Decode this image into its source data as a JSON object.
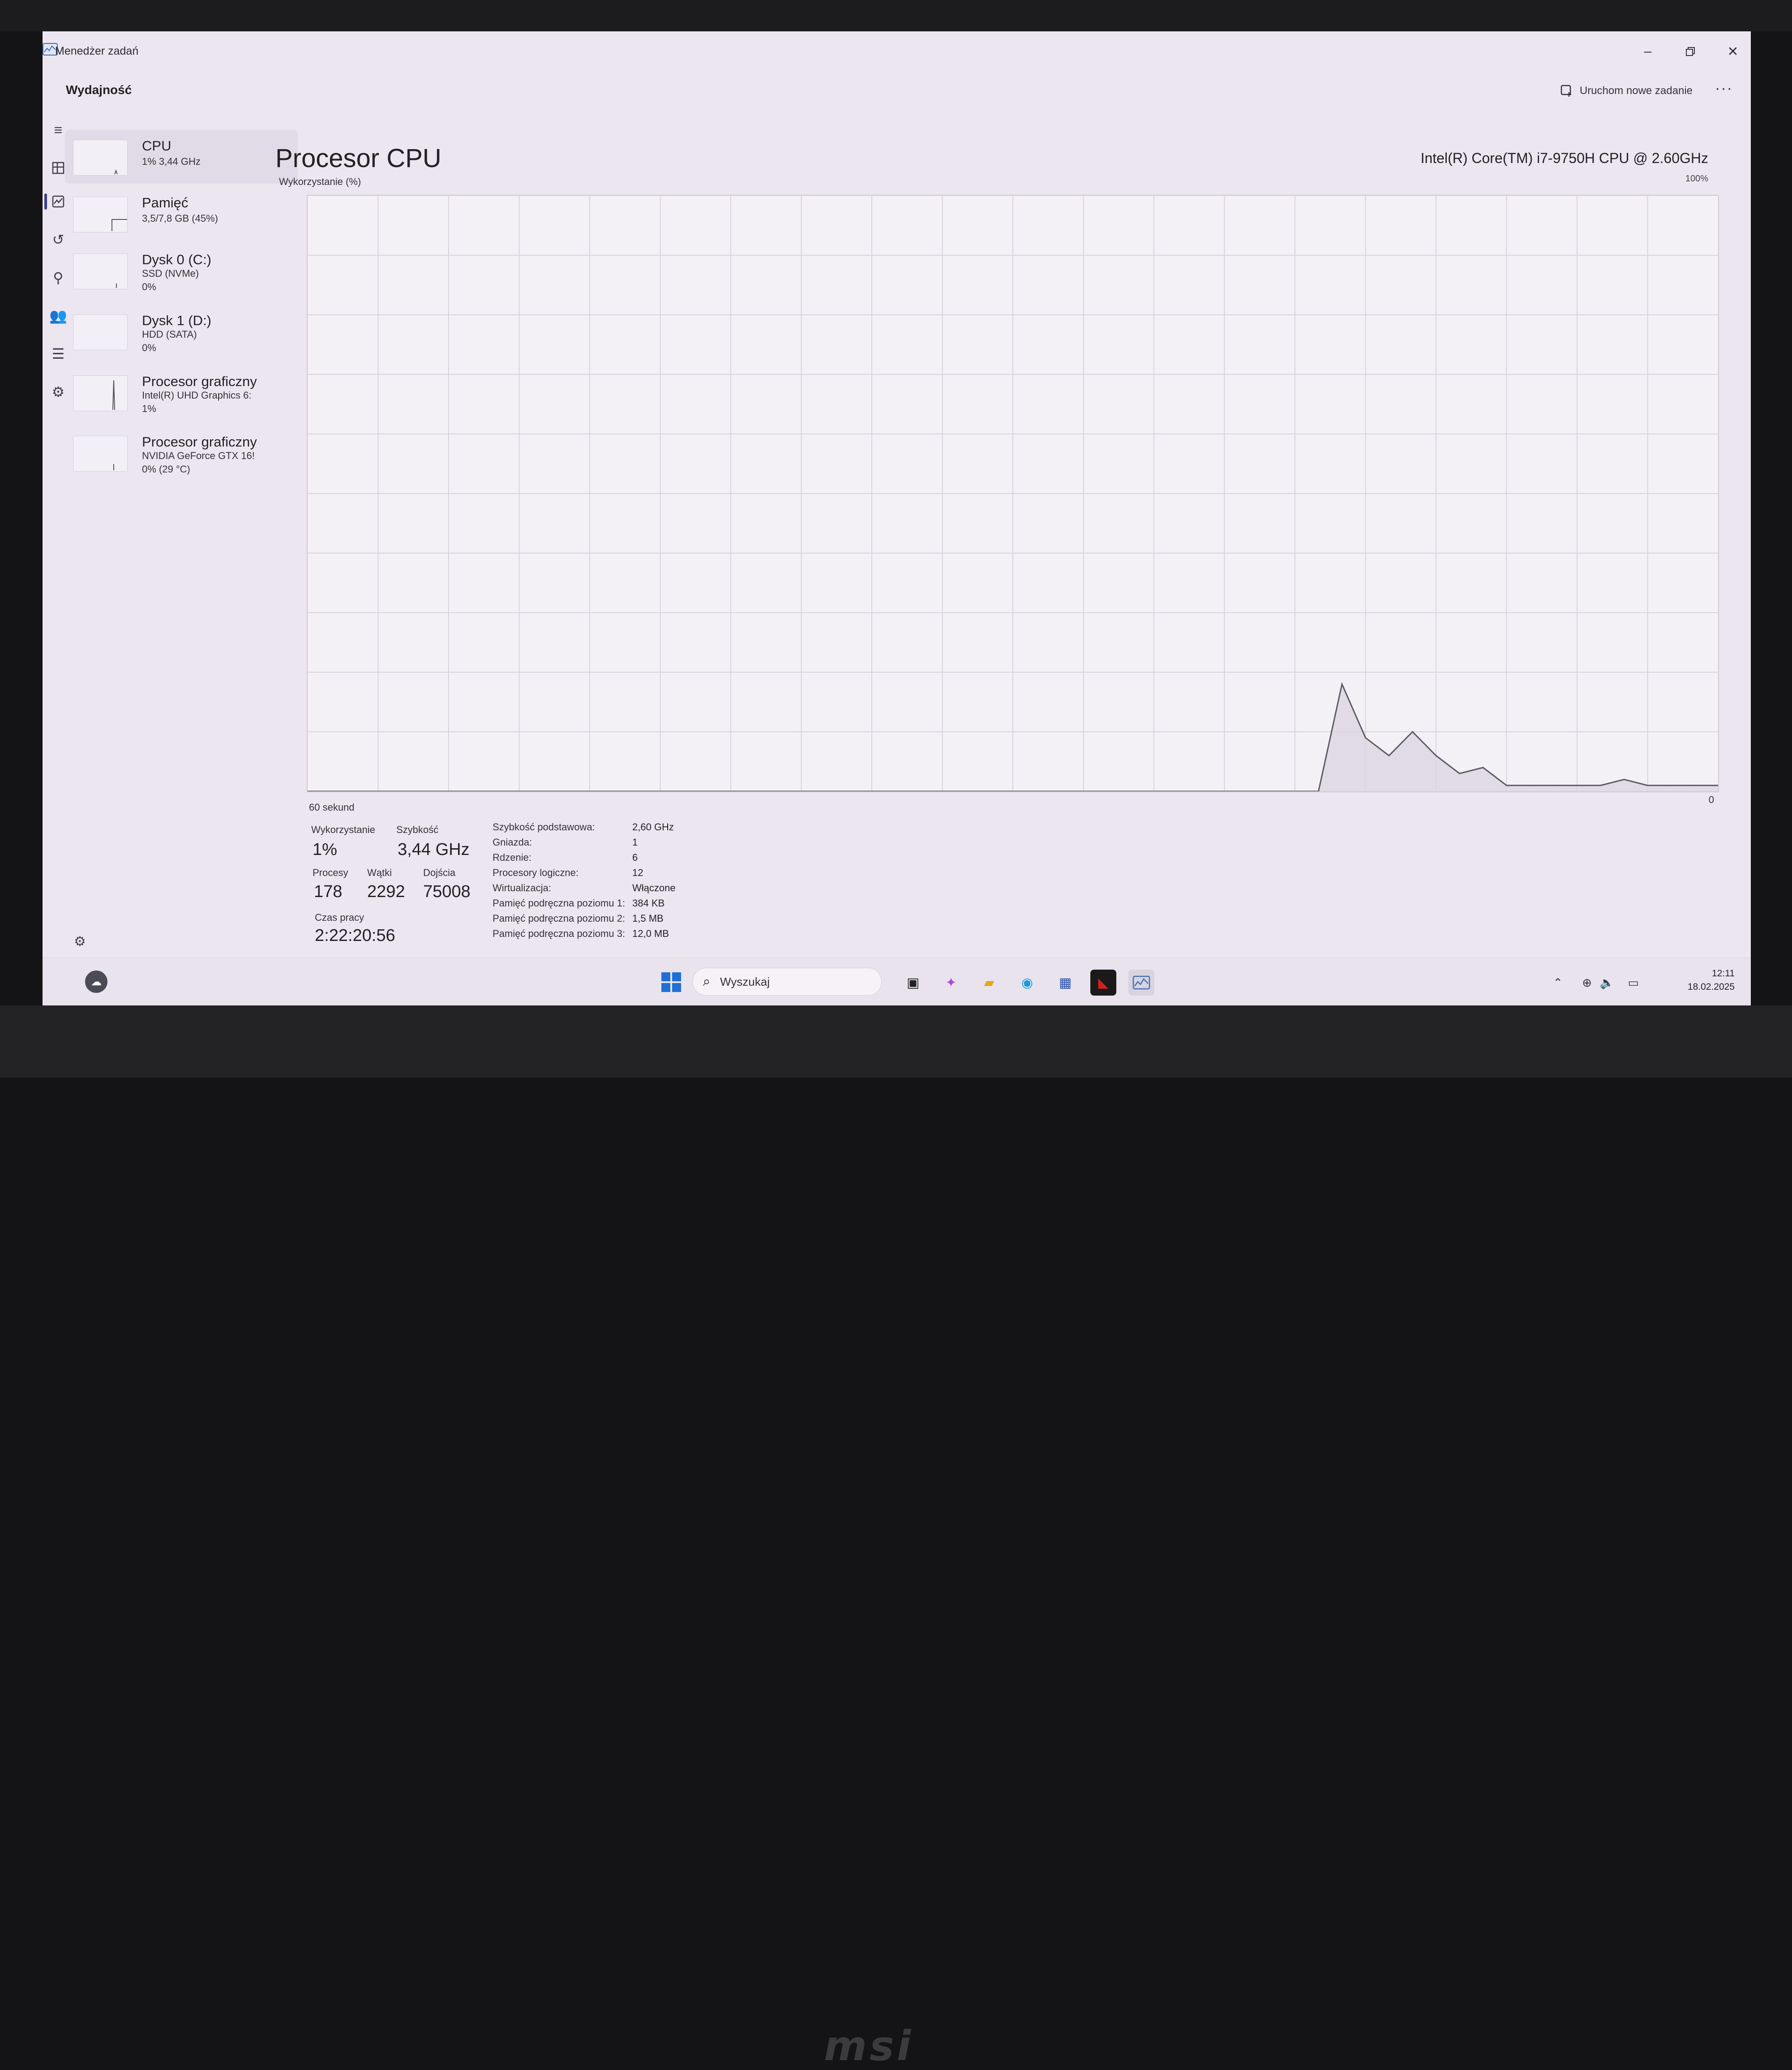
{
  "window": {
    "title": "Menedżer zadań"
  },
  "header": {
    "title": "Wydajność",
    "new_task_label": "Uruchom nowe zadanie",
    "more_label": "···"
  },
  "sidebar": {
    "items": [
      {
        "name": "CPU",
        "line1": "1% 3,44 GHz",
        "line2": ""
      },
      {
        "name": "Pamięć",
        "line1": "3,5/7,8 GB (45%)",
        "line2": ""
      },
      {
        "name": "Dysk 0 (C:)",
        "line1": "SSD (NVMe)",
        "line2": "0%"
      },
      {
        "name": "Dysk 1 (D:)",
        "line1": "HDD (SATA)",
        "line2": "0%"
      },
      {
        "name": "Procesor graficzny",
        "line1": "Intel(R) UHD Graphics 6:",
        "line2": "1%"
      },
      {
        "name": "Procesor graficzny",
        "line1": "NVIDIA GeForce GTX 16!",
        "line2": "0% (29 °C)"
      }
    ]
  },
  "main": {
    "title": "Procesor CPU",
    "cpu_model": "Intel(R) Core(TM) i7-9750H CPU @ 2.60GHz",
    "util_label": "Wykorzystanie (%)",
    "max_label": "100%",
    "x_left_label": "60 sekund",
    "x_right_label": "0"
  },
  "chart_data": {
    "type": "area",
    "title": "",
    "xlabel": "60 sekund",
    "ylabel": "Wykorzystanie (%)",
    "xlim": [
      60,
      0
    ],
    "ylim": [
      0,
      100
    ],
    "grid": true,
    "x": [
      60,
      17,
      16,
      15,
      14,
      13,
      12,
      11,
      10,
      9,
      8,
      7,
      6,
      5,
      4,
      3,
      2,
      1,
      0
    ],
    "series": [
      {
        "values": [
          0,
          0,
          18,
          9,
          6,
          10,
          6,
          3,
          4,
          1,
          1,
          1,
          1,
          1,
          2,
          1,
          1,
          1,
          1
        ]
      }
    ]
  },
  "stats": {
    "utilization": {
      "label": "Wykorzystanie",
      "value": "1%"
    },
    "speed": {
      "label": "Szybkość",
      "value": "3,44 GHz"
    },
    "processes": {
      "label": "Procesy",
      "value": "178"
    },
    "threads": {
      "label": "Wątki",
      "value": "2292"
    },
    "handles": {
      "label": "Dojścia",
      "value": "75008"
    },
    "uptime": {
      "label": "Czas pracy",
      "value": "2:22:20:56"
    }
  },
  "specs": [
    {
      "key": "Szybkość podstawowa:",
      "value": "2,60 GHz"
    },
    {
      "key": "Gniazda:",
      "value": "1"
    },
    {
      "key": "Rdzenie:",
      "value": "6"
    },
    {
      "key": "Procesory logiczne:",
      "value": "12"
    },
    {
      "key": "Wirtualizacja:",
      "value": "Włączone"
    },
    {
      "key": "Pamięć podręczna poziomu 1:",
      "value": "384 KB"
    },
    {
      "key": "Pamięć podręczna poziomu 2:",
      "value": "1,5 MB"
    },
    {
      "key": "Pamięć podręczna poziomu 3:",
      "value": "12,0 MB"
    }
  ],
  "taskbar": {
    "search_placeholder": "Wyszukaj",
    "time": "12:11",
    "date": "18.02.2025"
  },
  "colors": {
    "accent": "#3b3f8a",
    "graph_line": "#5a5a64",
    "graph_fill": "#dcd6e2"
  },
  "brand": "msi"
}
